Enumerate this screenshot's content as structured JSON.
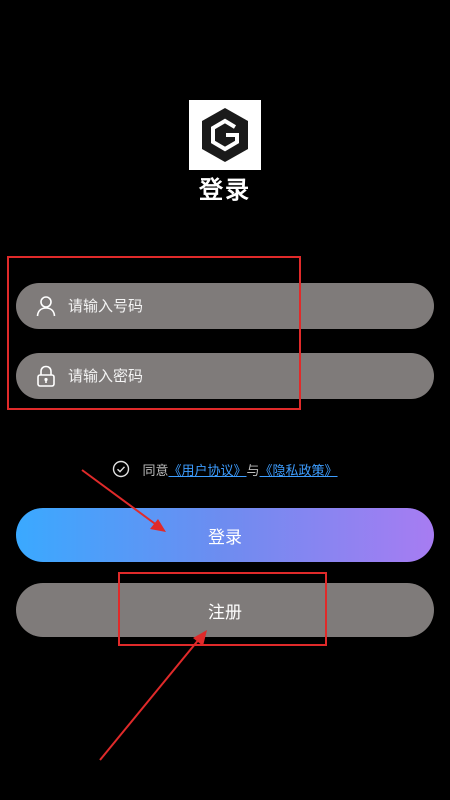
{
  "header": {
    "title": "登录"
  },
  "form": {
    "phone_placeholder": "请输入号码",
    "password_placeholder": "请输入密码"
  },
  "agreement": {
    "prefix": "同意",
    "user_agreement": "《用户协议》",
    "conjunction": "与",
    "privacy_policy": "《隐私政策》"
  },
  "buttons": {
    "login_label": "登录",
    "register_label": "注册"
  },
  "colors": {
    "field_bg": "#7f7b7a",
    "login_gradient_start": "#3aa9ff",
    "login_gradient_end": "#a77cf2",
    "link": "#3d9dff",
    "annotation": "#e02a2a"
  }
}
